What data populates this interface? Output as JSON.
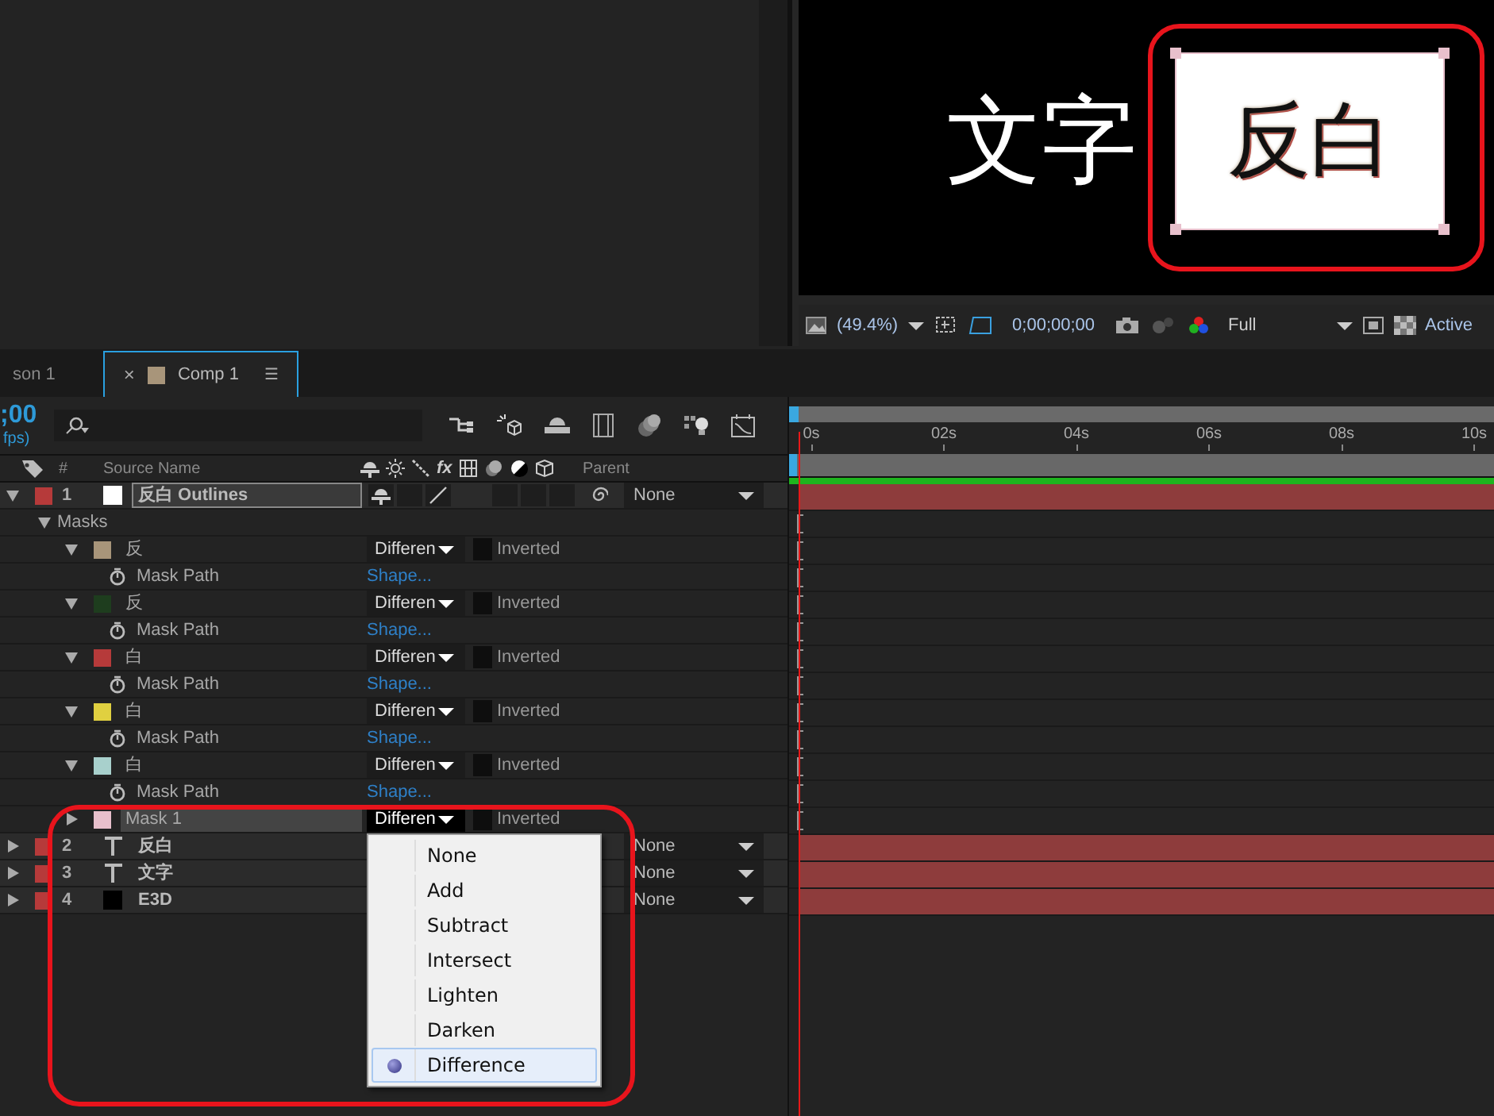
{
  "viewer": {
    "sample_text": "文字",
    "masked_text": "反白",
    "zoom": "(49.4%)",
    "timecode": "0;00;00;00",
    "resolution": "Full",
    "view": "Active"
  },
  "tabs": [
    {
      "label": "son 1",
      "selected": false
    },
    {
      "label": "Comp 1",
      "selected": true,
      "close": "×",
      "menu": "☰",
      "color": "#a8957a"
    }
  ],
  "timeline": {
    "timecode": ";00",
    "fps": "fps)",
    "columns": {
      "number": "#",
      "source_name": "Source Name",
      "fx": "fx",
      "parent": "Parent"
    },
    "layers": [
      {
        "number": "1",
        "name": "反白 Outlines",
        "kind": "shape",
        "color": "#b63a3a",
        "selected": true,
        "expanded": true,
        "parent": "None",
        "masks_label": "Masks",
        "masks": [
          {
            "name": "反",
            "color": "#a8957a",
            "selected": false,
            "expanded": true,
            "mode": "Differen",
            "inverted": false,
            "inverted_label": "Inverted",
            "property": "Mask Path",
            "value": "Shape..."
          },
          {
            "name": "反",
            "color": "#1e3d1e",
            "selected": false,
            "expanded": true,
            "mode": "Differen",
            "inverted": false,
            "inverted_label": "Inverted",
            "property": "Mask Path",
            "value": "Shape..."
          },
          {
            "name": "白",
            "color": "#b63a3a",
            "selected": false,
            "expanded": true,
            "mode": "Differen",
            "inverted": false,
            "inverted_label": "Inverted",
            "property": "Mask Path",
            "value": "Shape..."
          },
          {
            "name": "白",
            "color": "#e0d040",
            "selected": false,
            "expanded": true,
            "mode": "Differen",
            "inverted": false,
            "inverted_label": "Inverted",
            "property": "Mask Path",
            "value": "Shape..."
          },
          {
            "name": "白",
            "color": "#a8d0cc",
            "selected": false,
            "expanded": true,
            "mode": "Differen",
            "inverted": false,
            "inverted_label": "Inverted",
            "property": "Mask Path",
            "value": "Shape..."
          },
          {
            "name": "Mask 1",
            "color": "#e8c0cc",
            "selected": true,
            "expanded": false,
            "mode": "Differen",
            "inverted": false,
            "inverted_label": "Inverted"
          }
        ]
      },
      {
        "number": "2",
        "name": "反白",
        "kind": "text",
        "color": "#b63a3a",
        "selected": false,
        "expanded": false,
        "parent": "None"
      },
      {
        "number": "3",
        "name": "文字",
        "kind": "text",
        "color": "#b63a3a",
        "selected": false,
        "expanded": false,
        "parent": "None"
      },
      {
        "number": "4",
        "name": "E3D",
        "kind": "solid",
        "color": "#b63a3a",
        "selected": false,
        "expanded": false,
        "parent": "None"
      }
    ],
    "mode_menu": [
      {
        "label": "None",
        "selected": false
      },
      {
        "label": "Add",
        "selected": false
      },
      {
        "label": "Subtract",
        "selected": false
      },
      {
        "label": "Intersect",
        "selected": false
      },
      {
        "label": "Lighten",
        "selected": false
      },
      {
        "label": "Darken",
        "selected": false
      },
      {
        "label": "Difference",
        "selected": true
      }
    ],
    "ruler": [
      "0s",
      "02s",
      "04s",
      "06s",
      "08s",
      "10s"
    ]
  }
}
